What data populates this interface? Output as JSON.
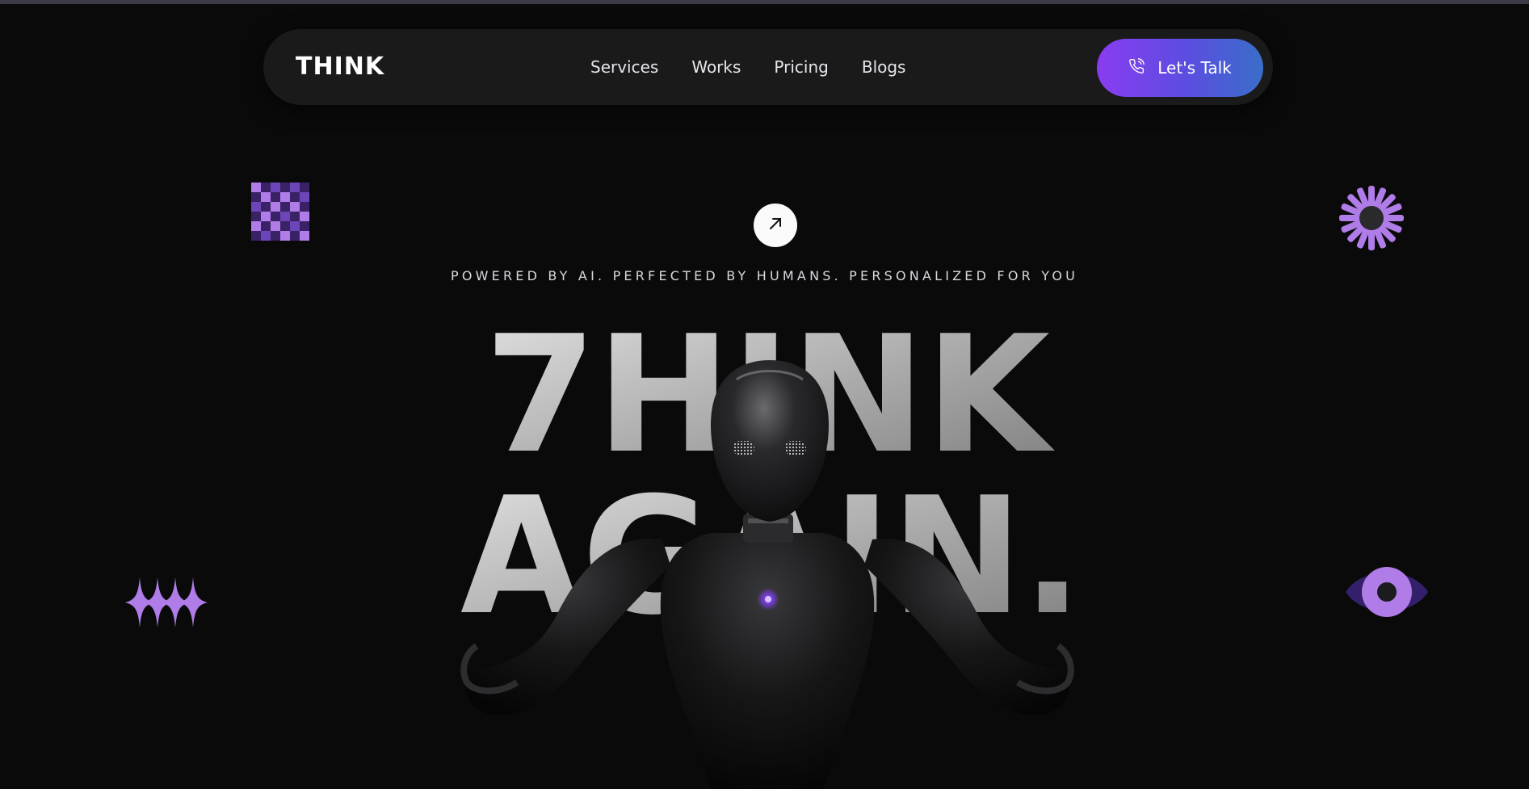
{
  "nav": {
    "logo": "THINK",
    "links": [
      "Services",
      "Works",
      "Pricing",
      "Blogs"
    ],
    "cta_label": "Let's Talk"
  },
  "hero": {
    "tagline": "POWERED BY AI. PERFECTED BY HUMANS. PERSONALIZED FOR YOU",
    "headline_line1": "7HINK",
    "headline_line2": "AGAIN."
  },
  "colors": {
    "background": "#0a0a0b",
    "nav_background": "#1a1a1b",
    "accent_purple": "#b07ce8",
    "cta_gradient_start": "#8a3cf0",
    "cta_gradient_end": "#3a6ec9"
  },
  "icons": {
    "cta_icon": "phone-icon",
    "hero_button_icon": "arrow-up-right-icon",
    "decorations": [
      "checkerboard-icon",
      "sunburst-icon",
      "sparkles-icon",
      "eye-icon"
    ]
  }
}
